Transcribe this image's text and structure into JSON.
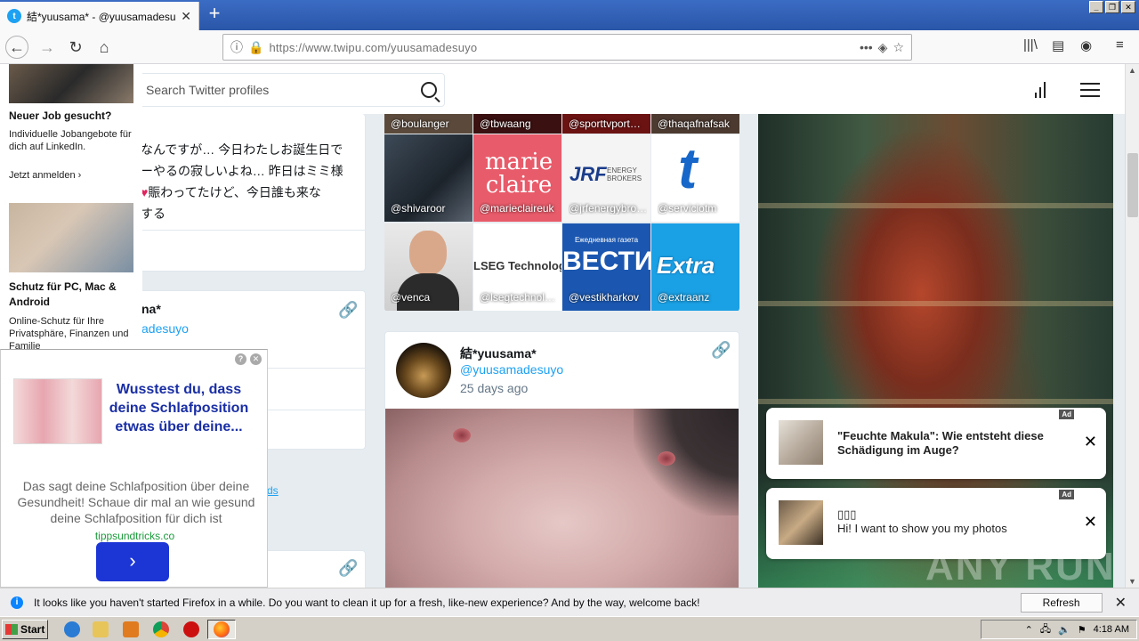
{
  "browser": {
    "tab_title": "結*yuusama* - @yuusamadesuyo",
    "tab_favicon": "t",
    "url": "https://www.twipu.com/yuusamadesuyo"
  },
  "header": {
    "search_placeholder": "Search Twitter profiles"
  },
  "left_ads": {
    "ad1_title": "Neuer Job gesucht?",
    "ad1_desc": "Individuelle Jobangebote für dich auf LinkedIn.",
    "ad1_cta": "Jetzt anmelden",
    "ad2_title": "Schutz für PC, Mac & Android",
    "ad2_desc": "Online-Schutz für Ihre Privatsphäre, Finanzen und Familie"
  },
  "tweet_text": {
    "line1": "なんですが… 今日わたしお誕生日で",
    "line2": "ーやるの寂しいよね… 昨日はミミ様",
    "line3_heart": "♥",
    "line3": "賑わってたけど、今日誰も来な",
    "line4": "する"
  },
  "profile_partial": {
    "name_tail": "na*",
    "handle_tail": "adesuyo",
    "link_tail": "ds"
  },
  "grid": {
    "top_row": [
      "@boulanger",
      "@tbwaang",
      "@sporttvport…",
      "@thaqafnafsak"
    ],
    "row2": [
      "@shivaroor",
      "@marieclaireuk",
      "@jrfenergybro…",
      "@serviciotm"
    ],
    "row3": [
      "@venca",
      "@lsegtechnol…",
      "@vestikharkov",
      "@extraanz"
    ],
    "logos": {
      "marie": "marie claire",
      "jrf": "JRF",
      "jrf_sub": "ENERGY BROKERS",
      "t": "t",
      "lseg": "LSEG Technology",
      "vesti_top": "Ежедневная газета",
      "vesti": "ВЕСТИ",
      "extra": "Extra"
    }
  },
  "post": {
    "name": "結*yuusama*",
    "handle": "@yuusamadesuyo",
    "time": "25 days ago"
  },
  "notifications": [
    {
      "ad": "Ad",
      "text": "\"Feuchte Makula\": Wie entsteht diese Schädigung im Auge?",
      "close": "✕"
    },
    {
      "ad": "Ad",
      "title": "▯▯▯",
      "text": "Hi! I want to show you my photos",
      "close": "✕"
    }
  ],
  "popup_ad": {
    "title": "Wusstest du, dass deine Schlafposition etwas über deine...",
    "desc": "Das sagt deine Schlafposition über deine Gesundheit! Schaue dir mal an wie gesund deine Schlafposition für dich ist",
    "domain": "tippsundtricks.co",
    "btn": "›"
  },
  "watermark": "ANY RUN",
  "infobar": {
    "message": "It looks like you haven't started Firefox in a while. Do you want to clean it up for a fresh, like-new experience? And by the way, welcome back!",
    "button": "Refresh Firefox…"
  },
  "taskbar": {
    "start": "Start",
    "clock": "4:18 AM"
  },
  "colors": {
    "twitter_blue": "#1da1f2",
    "popup_title": "#1a2fa5",
    "popup_button": "#1c36d6"
  }
}
